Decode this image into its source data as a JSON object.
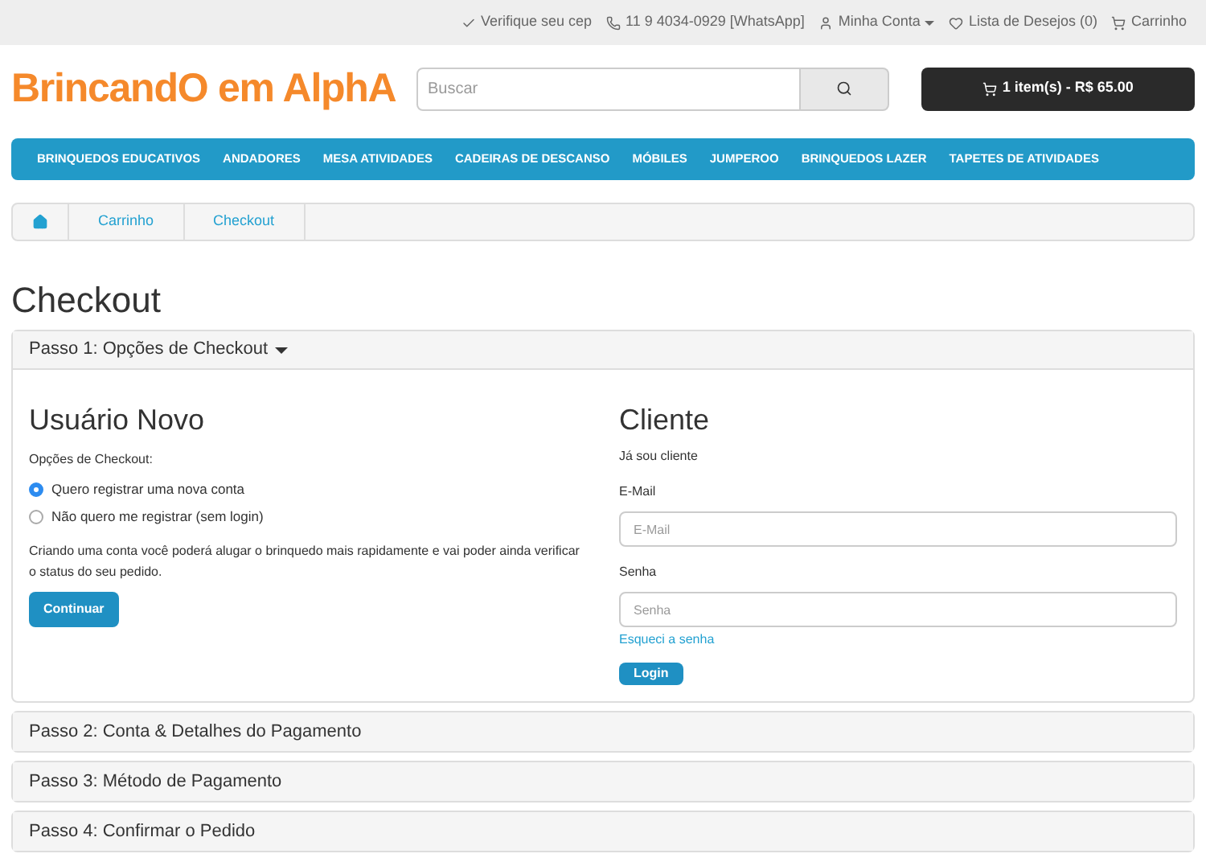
{
  "top_links": [
    {
      "label": "Verifique seu cep",
      "dropdown": false
    },
    {
      "label": "11 9 4034-0929 [WhatsApp]",
      "dropdown": false
    },
    {
      "label": "Minha Conta",
      "dropdown": true
    },
    {
      "label": "Lista de Desejos (0)",
      "dropdown": false
    },
    {
      "label": "Carrinho",
      "dropdown": false
    }
  ],
  "logo": "BrincandO em AlphA",
  "search": {
    "placeholder": "Buscar"
  },
  "cart_button": "1 item(s) - R$ 65.00",
  "nav": [
    "BRINQUEDOS EDUCATIVOS",
    "ANDADORES",
    "MESA ATIVIDADES",
    "CADEIRAS DE DESCANSO",
    "MÓBILES",
    "JUMPEROO",
    "BRINQUEDOS LAZER",
    "TAPETES DE ATIVIDADES"
  ],
  "breadcrumb": [
    "Carrinho",
    "Checkout"
  ],
  "page_title": "Checkout",
  "steps": [
    {
      "title": "Passo 1: Opções de Checkout",
      "expanded": true
    },
    {
      "title": "Passo 2: Conta & Detalhes do Pagamento",
      "expanded": false
    },
    {
      "title": "Passo 3: Método de Pagamento",
      "expanded": false
    },
    {
      "title": "Passo 4: Confirmar o Pedido",
      "expanded": false
    }
  ],
  "new_user": {
    "heading": "Usuário Novo",
    "label": "Opções de Checkout:",
    "options": [
      {
        "label": "Quero registrar uma nova conta",
        "selected": true
      },
      {
        "label": "Não quero me registrar (sem login)",
        "selected": false
      }
    ],
    "text": "Criando uma conta você poderá alugar o brinquedo mais rapidamente e vai poder ainda verificar o status do seu pedido.",
    "button": "Continuar"
  },
  "client": {
    "heading": "Cliente",
    "subtitle": "Já sou cliente",
    "fields": [
      {
        "label": "E-Mail",
        "placeholder": "E-Mail"
      },
      {
        "label": "Senha",
        "placeholder": "Senha"
      }
    ],
    "forgot_link": "Esqueci a senha",
    "button": "Login"
  }
}
